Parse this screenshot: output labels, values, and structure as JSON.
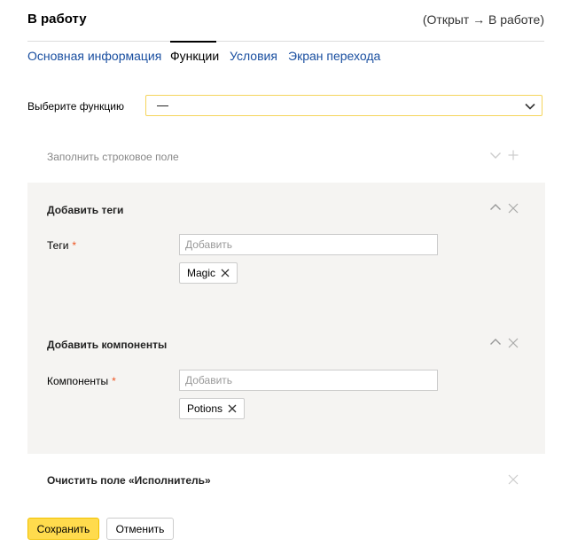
{
  "header": {
    "title": "В работу",
    "transition": "(Открыт → В работе)"
  },
  "tabs": [
    {
      "label": "Основная информация",
      "active": false
    },
    {
      "label": "Функции",
      "active": true
    },
    {
      "label": "Условия",
      "active": false
    },
    {
      "label": "Экран перехода",
      "active": false
    }
  ],
  "function_select": {
    "label": "Выберите функцию",
    "value": "—"
  },
  "functions": {
    "fill_string": {
      "title": "Заполнить строковое поле"
    },
    "add_tags": {
      "title": "Добавить теги",
      "field_label": "Теги",
      "required_mark": "*",
      "placeholder": "Добавить",
      "chips": [
        "Magic"
      ]
    },
    "add_components": {
      "title": "Добавить компоненты",
      "field_label": "Компоненты",
      "required_mark": "*",
      "placeholder": "Добавить",
      "chips": [
        "Potions"
      ]
    },
    "clear_assignee": {
      "title": "Очистить поле «Исполнитель»"
    }
  },
  "buttons": {
    "save": "Сохранить",
    "cancel": "Отменить"
  },
  "colors": {
    "accent_yellow": "#ffdb4d",
    "link_blue": "#1a4fa0",
    "panel_bg": "#f5f4f2",
    "required_red": "#ee5522"
  }
}
